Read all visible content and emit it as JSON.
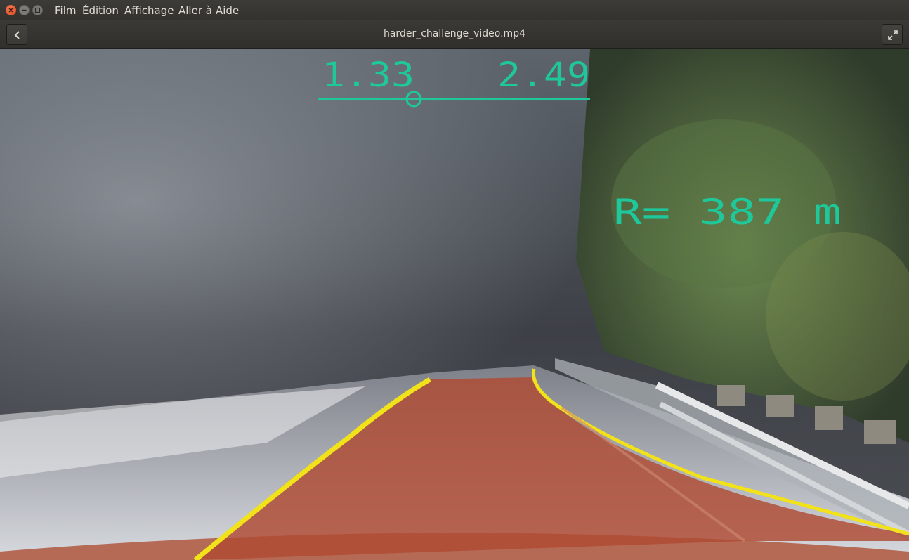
{
  "window": {
    "menu": [
      "Film",
      "Édition",
      "Affichage",
      "Aller à",
      "Aide"
    ],
    "title": "harder_challenge_video.mp4"
  },
  "icons": {
    "close": "close-icon",
    "minimize": "minimize-icon",
    "maximize": "maximize-icon",
    "back": "chevron-left-icon",
    "fullscreen": "fullscreen-icon"
  },
  "overlay": {
    "left_value": "1.33",
    "right_value": "2.49",
    "curvature_text": "R= 387 m",
    "text_color": "#1fc89b",
    "lane_fill_color": "#b04a33",
    "lane_line_color": "#f2e21a"
  }
}
